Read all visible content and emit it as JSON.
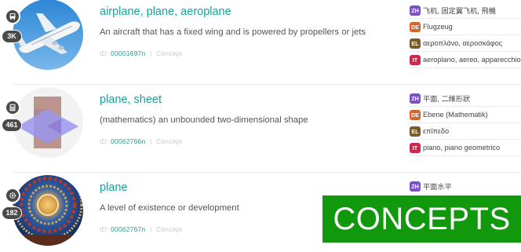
{
  "colors": {
    "accent": "#1aa197",
    "zh": "#7b52c5",
    "de": "#d8662b",
    "el": "#7a5c2b",
    "it": "#d0264f",
    "banner": "#12980c"
  },
  "entries": [
    {
      "title": "airplane, plane, aeroplane",
      "description": "An aircraft that has a fixed wing and is powered by propellers or jets",
      "id_label": "ID:",
      "id_value": "00001697n",
      "separator": "|",
      "kind": "Concept",
      "badge_icon": "bus-icon",
      "count": "3K",
      "translations": [
        {
          "code": "ZH",
          "text": "飞机, 固定翼飞机, 飛機"
        },
        {
          "code": "DE",
          "text": "Flugzeug"
        },
        {
          "code": "EL",
          "text": "αεροπλάνο, αεροσκάφος"
        },
        {
          "code": "IT",
          "text": "aeroplano, aereo, apparecchio"
        }
      ]
    },
    {
      "title": "plane, sheet",
      "description": "(mathematics) an unbounded two-dimensional shape",
      "id_label": "ID:",
      "id_value": "00062766n",
      "separator": "|",
      "kind": "Concept",
      "badge_icon": "calculator-icon",
      "count": "461",
      "translations": [
        {
          "code": "ZH",
          "text": "平面, 二維形狀"
        },
        {
          "code": "DE",
          "text": "Ebene (Mathematik)"
        },
        {
          "code": "EL",
          "text": "επίπεδο"
        },
        {
          "code": "IT",
          "text": "piano, piano geometrico"
        }
      ]
    },
    {
      "title": "plane",
      "description": "A level of existence or development",
      "id_label": "ID:",
      "id_value": "00062767n",
      "separator": "|",
      "kind": "Concept",
      "badge_icon": "gear-icon",
      "count": "182",
      "translations": [
        {
          "code": "ZH",
          "text": "平面水平"
        }
      ]
    }
  ],
  "banner": {
    "label": "CONCEPTS"
  }
}
